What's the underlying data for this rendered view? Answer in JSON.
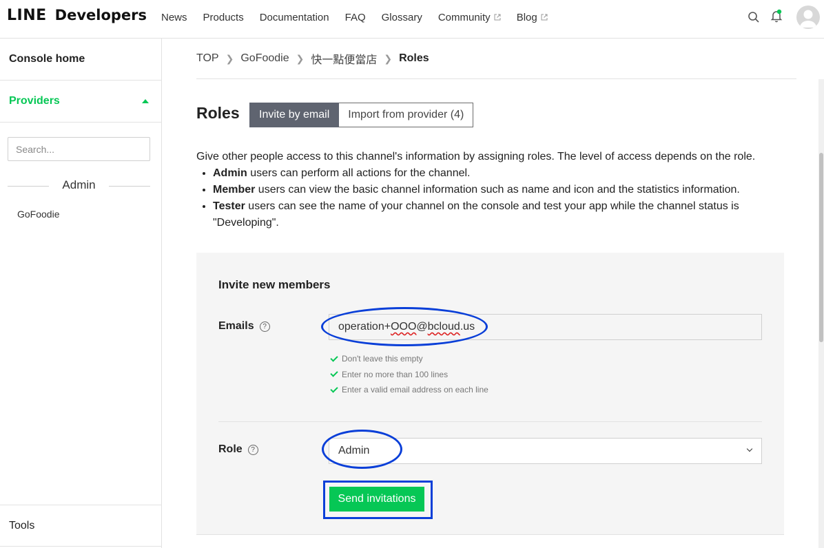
{
  "header": {
    "logo_line": "LINE",
    "logo_dev": "Developers",
    "nav": [
      {
        "label": "News",
        "external": false
      },
      {
        "label": "Products",
        "external": false
      },
      {
        "label": "Documentation",
        "external": false
      },
      {
        "label": "FAQ",
        "external": false
      },
      {
        "label": "Glossary",
        "external": false
      },
      {
        "label": "Community",
        "external": true
      },
      {
        "label": "Blog",
        "external": true
      }
    ]
  },
  "sidebar": {
    "console_home": "Console home",
    "providers": "Providers",
    "search_placeholder": "Search...",
    "role_divider": "Admin",
    "provider_item": "GoFoodie",
    "tools": "Tools"
  },
  "breadcrumb": {
    "items": [
      "TOP",
      "GoFoodie",
      "快一點便當店"
    ],
    "current": "Roles"
  },
  "page": {
    "title": "Roles",
    "tabs": {
      "active": "Invite by email",
      "inactive": "Import from provider (4)"
    },
    "intro": "Give other people access to this channel's information by assigning roles. The level of access depends on the role.",
    "bullets": [
      {
        "role": "Admin",
        "text": " users can perform all actions for the channel."
      },
      {
        "role": "Member",
        "text": " users can view the basic channel information such as name and icon and the statistics information."
      },
      {
        "role": "Tester",
        "text": " users can see the name of your channel on the console and test your app while the channel status is \"Developing\"."
      }
    ]
  },
  "invite": {
    "title": "Invite new members",
    "emails_label": "Emails",
    "email_prefix": "operation+",
    "email_squiggle_1": "OOO",
    "email_at": "@",
    "email_squiggle_2": "bcloud",
    "email_suffix": ".us",
    "checks": [
      "Don't leave this empty",
      "Enter no more than 100 lines",
      "Enter a valid email address on each line"
    ],
    "role_label": "Role",
    "role_value": "Admin",
    "send_label": "Send invitations",
    "help_glyph": "?"
  },
  "colors": {
    "brand_green": "#06c755",
    "annotation_blue": "#0a3fd8",
    "tab_active_bg": "#5f6470"
  }
}
